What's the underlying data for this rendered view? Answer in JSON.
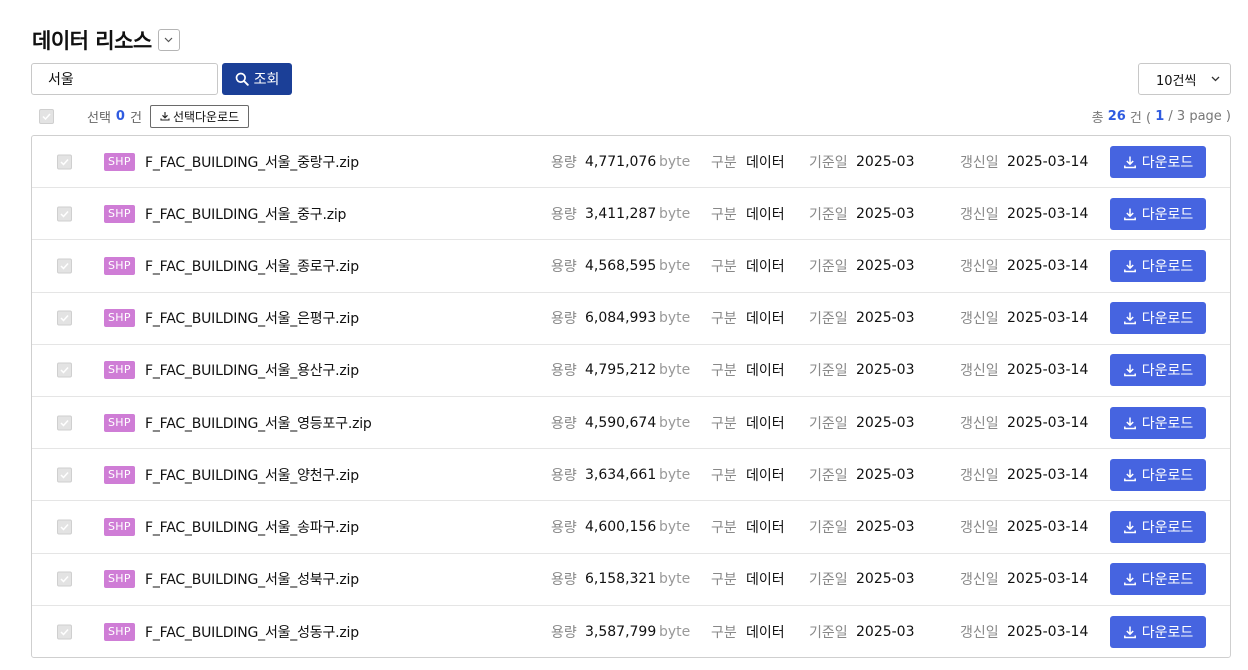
{
  "title": "데이터 리소스",
  "search": {
    "value": "서울",
    "button_label": "조회"
  },
  "page_size": "10건씩",
  "selection": {
    "label": "선택",
    "count": "0",
    "unit": "건",
    "download_label": "선택다운로드"
  },
  "total": {
    "prefix": "총 ",
    "count": "26",
    "unit": " 건 ( ",
    "page": "1",
    "pages_suffix": " / 3 page )"
  },
  "labels": {
    "size": "용량",
    "byte": "byte",
    "type": "구분",
    "base_date": "기준일",
    "updated": "갱신일",
    "download": "다운로드"
  },
  "rows": [
    {
      "badge": "SHP",
      "name": "F_FAC_BUILDING_서울_중랑구.zip",
      "size": "4,771,076",
      "type": "데이터",
      "base_date": "2025-03",
      "updated": "2025-03-14"
    },
    {
      "badge": "SHP",
      "name": "F_FAC_BUILDING_서울_중구.zip",
      "size": "3,411,287",
      "type": "데이터",
      "base_date": "2025-03",
      "updated": "2025-03-14"
    },
    {
      "badge": "SHP",
      "name": "F_FAC_BUILDING_서울_종로구.zip",
      "size": "4,568,595",
      "type": "데이터",
      "base_date": "2025-03",
      "updated": "2025-03-14"
    },
    {
      "badge": "SHP",
      "name": "F_FAC_BUILDING_서울_은평구.zip",
      "size": "6,084,993",
      "type": "데이터",
      "base_date": "2025-03",
      "updated": "2025-03-14"
    },
    {
      "badge": "SHP",
      "name": "F_FAC_BUILDING_서울_용산구.zip",
      "size": "4,795,212",
      "type": "데이터",
      "base_date": "2025-03",
      "updated": "2025-03-14"
    },
    {
      "badge": "SHP",
      "name": "F_FAC_BUILDING_서울_영등포구.zip",
      "size": "4,590,674",
      "type": "데이터",
      "base_date": "2025-03",
      "updated": "2025-03-14"
    },
    {
      "badge": "SHP",
      "name": "F_FAC_BUILDING_서울_양천구.zip",
      "size": "3,634,661",
      "type": "데이터",
      "base_date": "2025-03",
      "updated": "2025-03-14"
    },
    {
      "badge": "SHP",
      "name": "F_FAC_BUILDING_서울_송파구.zip",
      "size": "4,600,156",
      "type": "데이터",
      "base_date": "2025-03",
      "updated": "2025-03-14"
    },
    {
      "badge": "SHP",
      "name": "F_FAC_BUILDING_서울_성북구.zip",
      "size": "6,158,321",
      "type": "데이터",
      "base_date": "2025-03",
      "updated": "2025-03-14"
    },
    {
      "badge": "SHP",
      "name": "F_FAC_BUILDING_서울_성동구.zip",
      "size": "3,587,799",
      "type": "데이터",
      "base_date": "2025-03",
      "updated": "2025-03-14"
    }
  ],
  "colors": {
    "primary_dark": "#1b3f97",
    "download_blue": "#4664e0",
    "badge_purple": "#cf7dd6",
    "accent_blue": "#2f5be0"
  }
}
